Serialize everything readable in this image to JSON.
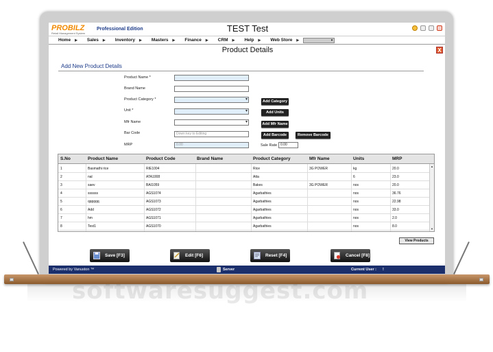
{
  "app": {
    "logo": "PROBILZ",
    "logo_sub": "Retail Management System",
    "edition": "Professional Edition",
    "title": "TEST Test"
  },
  "menu": [
    {
      "label": "Home"
    },
    {
      "label": "Sales"
    },
    {
      "label": "Inventory"
    },
    {
      "label": "Masters"
    },
    {
      "label": "Finance"
    },
    {
      "label": "CRM"
    },
    {
      "label": "Help"
    },
    {
      "label": "Web Store"
    }
  ],
  "page": {
    "title": "Product Details",
    "close": "X",
    "section": "Add New Product Details"
  },
  "form": {
    "product_name_label": "Product Name *",
    "brand_name_label": "Brand Name",
    "category_label": "Product Category *",
    "unit_label": "Unit *",
    "mfr_label": "Mfr Name",
    "barcode_label": "Bar Code",
    "barcode_placeholder": "Down key to Editing",
    "mrp_label": "MRP",
    "mrp_value": "0.00",
    "sale_rate_label": "Sale Rate",
    "sale_rate_value": "0.00",
    "add_category": "Add Category",
    "add_units": "Add Units",
    "add_mfr": "Add Mfr Name",
    "add_barcode": "Add Barcode",
    "remove_barcode": "Remove Barcode"
  },
  "table": {
    "headers": [
      "S.No",
      "Product Name",
      "Product Code",
      "Brand Name",
      "Product Category",
      "Mfr Name",
      "Units",
      "MRP"
    ],
    "rows": [
      [
        "1",
        "Basmathi rice",
        "RIE1004",
        "",
        "Rice",
        "3G POWER",
        "kg",
        "20.0"
      ],
      [
        "2",
        "nal",
        "ATA1008",
        "",
        "Atta",
        "",
        "6",
        "23.0"
      ],
      [
        "3",
        "saev",
        "BAI1059",
        "",
        "Bakes",
        "3G POWER",
        "nos",
        "20.0"
      ],
      [
        "4",
        "ssssss",
        "AGS1074",
        "",
        "Agarbathies",
        "",
        "nos",
        "36.76"
      ],
      [
        "5",
        "qqqqqq",
        "AGS1073",
        "",
        "Agarbathies",
        "",
        "nos",
        "22.98"
      ],
      [
        "6",
        "Add",
        "AGS1072",
        "",
        "Agarbathies",
        "",
        "nos",
        "33.0"
      ],
      [
        "7",
        "hm",
        "AGS1071",
        "",
        "Agarbathies",
        "",
        "nos",
        "2.0"
      ],
      [
        "8",
        "Test1",
        "AGS1070",
        "",
        "Agarbathies",
        "",
        "nos",
        "8.0"
      ]
    ]
  },
  "view_products": "View Products",
  "actions": {
    "save": "Save [F3]",
    "edit": "Edit [F6]",
    "reset": "Reset [F4]",
    "cancel": "Cancel [F8]"
  },
  "footer": {
    "powered": "Powered by Vanuston ™",
    "server": "Server",
    "current_user": "Current User :",
    "current_user_value": "!"
  },
  "watermark": "softwaresuggest.com",
  "colors": {
    "accent": "#1b3a88",
    "footer": "#1b2f6c",
    "close": "#e25b2c",
    "logo": "#f18a00"
  }
}
